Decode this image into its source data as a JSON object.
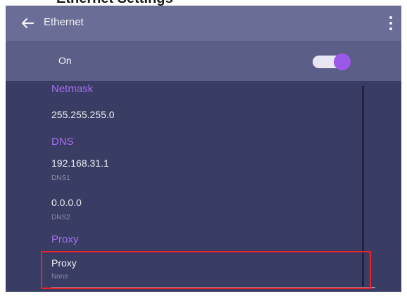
{
  "page_caption": "Ethernet Settings",
  "titlebar": {
    "title": "Ethernet",
    "back_icon": "arrow-left-icon",
    "menu_icon": "more-vert-icon"
  },
  "switch_row": {
    "label": "On",
    "state": "on",
    "accent": "#9c58ea"
  },
  "sections": {
    "netmask": {
      "header": "Netmask",
      "value": "255.255.255.0"
    },
    "dns": {
      "header": "DNS",
      "dns1_value": "192.168.31.1",
      "dns1_label": "DNS1",
      "dns2_value": "0.0.0.0",
      "dns2_label": "DNS2"
    },
    "proxy": {
      "header": "Proxy",
      "item_title": "Proxy",
      "item_value": "None"
    }
  },
  "colors": {
    "titlebar_bg": "#6a6d95",
    "content_bg": "#3a3d63",
    "section_header": "#a46cf0",
    "highlight_border": "#e8232e"
  }
}
